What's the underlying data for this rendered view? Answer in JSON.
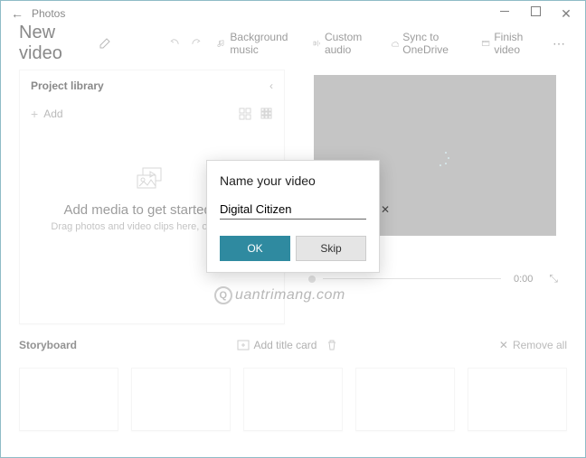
{
  "window": {
    "title": "Photos"
  },
  "header": {
    "video_title": "New video",
    "undo": "Undo",
    "redo": "Redo",
    "bg_music": "Background music",
    "custom_audio": "Custom audio",
    "sync": "Sync to OneDrive",
    "finish": "Finish video"
  },
  "library": {
    "title": "Project library",
    "add": "Add",
    "empty_heading": "Add media to get started now",
    "empty_sub": "Drag photos and video clips here, or click Add"
  },
  "preview": {
    "time": "0:00"
  },
  "storyboard": {
    "title": "Storyboard",
    "add_title": "Add title card",
    "trash": "Delete",
    "remove_all": "Remove all"
  },
  "modal": {
    "heading": "Name your video",
    "value": "Digital Citizen",
    "ok": "OK",
    "skip": "Skip"
  },
  "watermark": "uantrimang.com",
  "colors": {
    "accent": "#2f8aa0"
  }
}
